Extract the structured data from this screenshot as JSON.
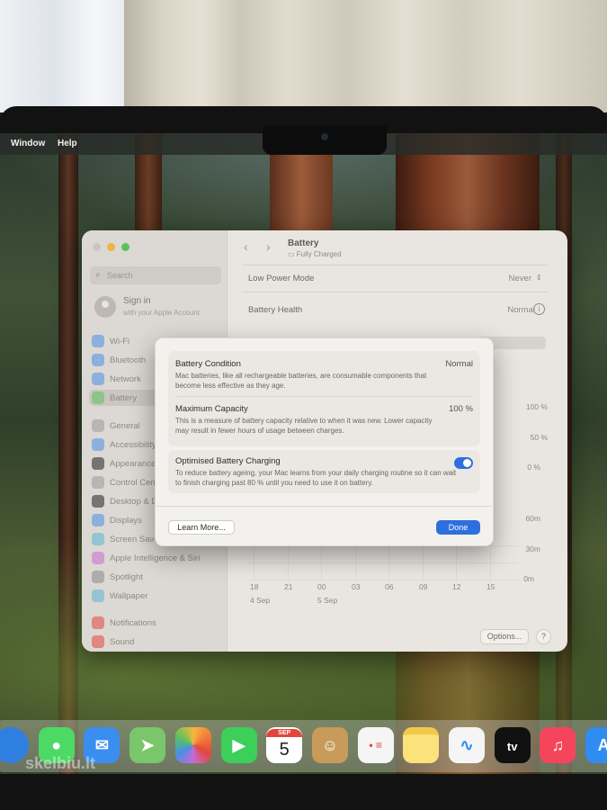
{
  "menubar": {
    "items": [
      "Window",
      "Help"
    ]
  },
  "sidebar": {
    "search_placeholder": "Search",
    "signin_title": "Sign in",
    "signin_subtitle": "with your Apple Account",
    "items": [
      {
        "label": "Wi-Fi",
        "icon": "wifi-icon",
        "color": "#4a8fe6"
      },
      {
        "label": "Bluetooth",
        "icon": "bluetooth-icon",
        "color": "#4a8fe6"
      },
      {
        "label": "Network",
        "icon": "globe-icon",
        "color": "#4a8fe6"
      },
      {
        "label": "Battery",
        "icon": "battery-icon",
        "color": "#5cc15c",
        "selected": true
      },
      {
        "label": "General",
        "icon": "gear-icon",
        "color": "#9a9a9a"
      },
      {
        "label": "Accessibility",
        "icon": "accessibility-icon",
        "color": "#4a8fe6"
      },
      {
        "label": "Appearance",
        "icon": "appearance-icon",
        "color": "#222222"
      },
      {
        "label": "Control Centre",
        "icon": "control-centre-icon",
        "color": "#9a9a9a"
      },
      {
        "label": "Desktop & Dock",
        "icon": "dock-icon",
        "color": "#222222"
      },
      {
        "label": "Displays",
        "icon": "display-icon",
        "color": "#4a8fe6"
      },
      {
        "label": "Screen Saver",
        "icon": "screen-saver-icon",
        "color": "#5ab4d6"
      },
      {
        "label": "Apple Intelligence & Siri",
        "icon": "siri-icon",
        "color": "#c46bd6"
      },
      {
        "label": "Spotlight",
        "icon": "spotlight-icon",
        "color": "#8a8a8a"
      },
      {
        "label": "Wallpaper",
        "icon": "wallpaper-icon",
        "color": "#5ab4d6"
      },
      {
        "label": "Notifications",
        "icon": "bell-icon",
        "color": "#e2453c"
      },
      {
        "label": "Sound",
        "icon": "speaker-icon",
        "color": "#e2453c"
      }
    ]
  },
  "content": {
    "title": "Battery",
    "subtitle": "Fully Charged",
    "low_power_label": "Low Power Mode",
    "low_power_value": "Never",
    "health_label": "Battery Health",
    "health_value": "Normal",
    "y_ticks_pct": [
      "100 %",
      "50 %",
      "0 %"
    ],
    "y_ticks_time": [
      "60m",
      "30m",
      "0m"
    ],
    "x_ticks": [
      "18",
      "21",
      "00",
      "03",
      "06",
      "09",
      "12",
      "15"
    ],
    "x_dates": [
      "4 Sep",
      "5 Sep"
    ],
    "options_label": "Options...",
    "help_label": "?"
  },
  "sheet": {
    "condition_title": "Battery Condition",
    "condition_value": "Normal",
    "condition_desc": "Mac batteries, like all rechargeable batteries, are consumable components that become less effective as they age.",
    "capacity_title": "Maximum Capacity",
    "capacity_value": "100 %",
    "capacity_desc": "This is a measure of battery capacity relative to when it was new. Lower capacity may result in fewer hours of usage between charges.",
    "optimised_title": "Optimised Battery Charging",
    "optimised_desc": "To reduce battery ageing, your Mac learns from your daily charging routine so it can wait to finish charging past 80 % until you need to use it on battery.",
    "optimised_on": true,
    "learn_more_label": "Learn More...",
    "done_label": "Done"
  },
  "dock": {
    "calendar_month": "SEP",
    "calendar_day": "5",
    "tv_label": "tv",
    "items": [
      {
        "name": "safari-icon",
        "color": "#2f7fe0"
      },
      {
        "name": "messages-icon",
        "color": "#4cd964"
      },
      {
        "name": "mail-icon",
        "color": "#3a8ef0"
      },
      {
        "name": "maps-icon",
        "color": "#7ac66b"
      },
      {
        "name": "photos-icon",
        "color": "#f3f3f3"
      },
      {
        "name": "facetime-icon",
        "color": "#3ccf5a"
      },
      {
        "name": "calendar-icon",
        "color": "#ffffff"
      },
      {
        "name": "contacts-icon",
        "color": "#c89b5a"
      },
      {
        "name": "reminders-icon",
        "color": "#f5f5f5"
      },
      {
        "name": "notes-icon",
        "color": "#fbe27a"
      },
      {
        "name": "freeform-icon",
        "color": "#f5f5f5"
      },
      {
        "name": "apple-tv-icon",
        "color": "#111111"
      },
      {
        "name": "music-icon",
        "color": "#f5455c"
      },
      {
        "name": "app-store-icon",
        "color": "#2f8cf0"
      }
    ]
  },
  "watermark": "skelbiu.lt",
  "colors": {
    "accent": "#2d6fde",
    "toggle_on": "#2f6fe0"
  }
}
